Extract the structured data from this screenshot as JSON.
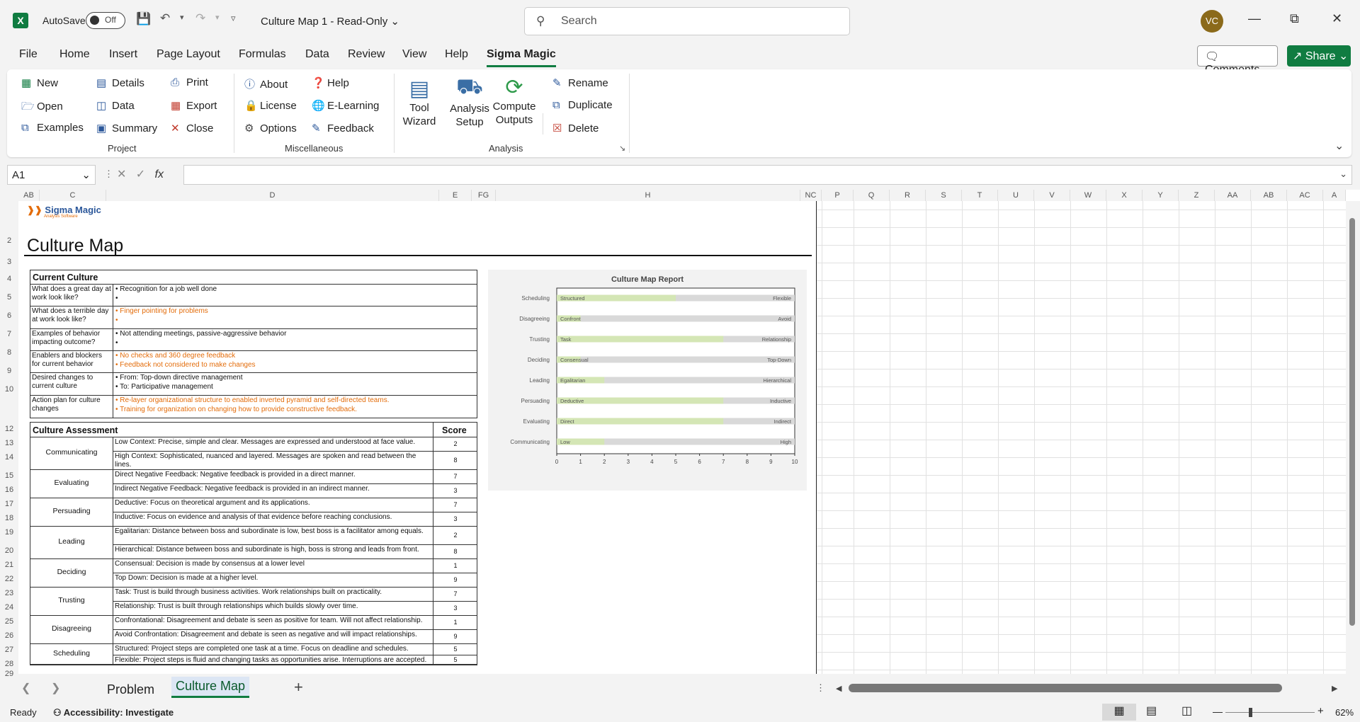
{
  "titlebar": {
    "autosave_label": "AutoSave",
    "toggle_state": "Off",
    "doc_title": "Culture Map 1  -  Read-Only",
    "search_placeholder": "Search",
    "user_initials": "VC"
  },
  "menu": {
    "items": [
      "File",
      "Home",
      "Insert",
      "Page Layout",
      "Formulas",
      "Data",
      "Review",
      "View",
      "Help",
      "Sigma Magic"
    ],
    "active": "Sigma Magic",
    "comments_label": "Comments",
    "share_label": "Share"
  },
  "ribbon": {
    "project": {
      "label": "Project",
      "buttons": [
        "New",
        "Open",
        "Examples",
        "Details",
        "Data",
        "Summary",
        "Print",
        "Export",
        "Close"
      ]
    },
    "misc": {
      "label": "Miscellaneous",
      "buttons": [
        "About",
        "License",
        "Options",
        "Help",
        "E-Learning",
        "Feedback"
      ]
    },
    "analysis": {
      "label": "Analysis",
      "tool_wizard": [
        "Tool",
        "Wizard"
      ],
      "analysis_setup": [
        "Analysis",
        "Setup"
      ],
      "compute_outputs": [
        "Compute",
        "Outputs"
      ],
      "buttons": [
        "Rename",
        "Duplicate",
        "Delete"
      ]
    }
  },
  "formula_bar": {
    "cell_ref": "A1",
    "fx_label": "fx",
    "value": ""
  },
  "columns": [
    "AB",
    "C",
    "D",
    "E",
    "FG",
    "H",
    "NC",
    "P",
    "Q",
    "R",
    "S",
    "T",
    "U",
    "V",
    "W",
    "X",
    "Y",
    "Z",
    "AA",
    "AB",
    "AC",
    "A"
  ],
  "rows": [
    "2",
    "3",
    "4",
    "5",
    "6",
    "7",
    "8",
    "9",
    "10",
    "12",
    "13",
    "14",
    "15",
    "16",
    "17",
    "18",
    "19",
    "20",
    "21",
    "22",
    "23",
    "24",
    "25",
    "26",
    "27",
    "28",
    "29"
  ],
  "doc": {
    "logo_name": "Sigma Magic",
    "logo_sub": "Analysis Software",
    "title": "Culture Map",
    "current_culture": {
      "header": "Current Culture",
      "rows": [
        {
          "q": "What does a great day at work look like?",
          "a": [
            "• Recognition for a job well done",
            "•"
          ],
          "orange": false
        },
        {
          "q": "What does a terrible day at work look like?",
          "a": [
            "• Finger pointing for problems",
            "•"
          ],
          "orange": true
        },
        {
          "q": "Examples of behavior impacting outcome?",
          "a": [
            "• Not attending meetings, passive-aggressive behavior",
            "•"
          ],
          "orange": false
        },
        {
          "q": "Enablers and blockers for current behavior",
          "a": [
            "• No checks and 360 degree feedback",
            "• Feedback not considered to make changes"
          ],
          "orange": true
        },
        {
          "q": "Desired changes to current culture",
          "a": [
            "• From: Top-down directive management",
            "• To: Participative management"
          ],
          "orange": false
        },
        {
          "q": "Action plan for culture changes",
          "a": [
            "• Re-layer organizational structure to enabled inverted pyramid and self-directed teams.",
            "• Training for organization on changing how to provide constructive feedback."
          ],
          "orange": true
        }
      ]
    },
    "assessment": {
      "header": "Culture Assessment",
      "score_header": "Score",
      "groups": [
        {
          "cat": "Communicating",
          "items": [
            {
              "text": "Low Context: Precise, simple and clear. Messages are expressed and understood at face value.",
              "score": "2",
              "orange": false
            },
            {
              "text": "High Context: Sophisticated, nuanced and layered. Messages are spoken and read between the lines.",
              "score": "8",
              "orange": false
            }
          ]
        },
        {
          "cat": "Evaluating",
          "items": [
            {
              "text": "Direct Negative Feedback: Negative feedback is provided in a direct manner.",
              "score": "7",
              "orange": true
            },
            {
              "text": "Indirect Negative Feedback: Negative feedback is provided in an indirect manner.",
              "score": "3",
              "orange": true
            }
          ]
        },
        {
          "cat": "Persuading",
          "items": [
            {
              "text": "Deductive: Focus on theoretical argument and its applications.",
              "score": "7",
              "orange": false
            },
            {
              "text": "Inductive: Focus on evidence and analysis of that evidence before reaching conclusions.",
              "score": "3",
              "orange": false
            }
          ]
        },
        {
          "cat": "Leading",
          "items": [
            {
              "text": "Egalitarian: Distance between boss and subordinate is low, best boss is a facilitator among equals.",
              "score": "2",
              "orange": true
            },
            {
              "text": "Hierarchical: Distance between boss and subordinate is high, boss is strong and leads from front.",
              "score": "8",
              "orange": true
            }
          ]
        },
        {
          "cat": "Deciding",
          "items": [
            {
              "text": "Consensual: Decision is made by consensus at a lower level",
              "score": "1",
              "orange": false
            },
            {
              "text": "Top Down: Decision is made at a higher level.",
              "score": "9",
              "orange": false
            }
          ]
        },
        {
          "cat": "Trusting",
          "items": [
            {
              "text": "Task: Trust is build through business activities. Work relationships built on practicality.",
              "score": "7",
              "orange": true
            },
            {
              "text": "Relationship: Trust is built through relationships which builds slowly over time.",
              "score": "3",
              "orange": true
            }
          ]
        },
        {
          "cat": "Disagreeing",
          "items": [
            {
              "text": "Confrontational: Disagreement and debate is seen as positive for team. Will not affect relationship.",
              "score": "1",
              "orange": false
            },
            {
              "text": "Avoid Confrontation: Disagreement and debate is seen as negative and will impact relationships.",
              "score": "9",
              "orange": false
            }
          ]
        },
        {
          "cat": "Scheduling",
          "items": [
            {
              "text": "Structured: Project steps are completed one task at a time. Focus on deadline and schedules.",
              "score": "5",
              "orange": true
            },
            {
              "text": "Flexible: Project steps is fluid and changing tasks as opportunities arise. Interruptions are accepted.",
              "score": "5",
              "orange": true
            }
          ]
        }
      ]
    }
  },
  "chart_data": {
    "type": "bar",
    "title": "Culture Map Report",
    "categories": [
      "Scheduling",
      "Disagreeing",
      "Trusting",
      "Deciding",
      "Leading",
      "Persuading",
      "Evaluating",
      "Communicating"
    ],
    "left_labels": [
      "Structured",
      "Confront",
      "Task",
      "Consensual",
      "Egalitarian",
      "Deductive",
      "Direct",
      "Low"
    ],
    "right_labels": [
      "Flexible",
      "Avoid",
      "Relationship",
      "Top-Down",
      "Hierarchical",
      "Inductive",
      "Indirect",
      "High"
    ],
    "values": [
      5,
      1,
      7,
      1,
      2,
      7,
      7,
      2
    ],
    "xlim": [
      0,
      10
    ],
    "xticks": [
      "0",
      "1",
      "2",
      "3",
      "4",
      "5",
      "6",
      "7",
      "8",
      "9",
      "10"
    ],
    "colors": {
      "value": "#d4e6b5",
      "remainder": "#d9d9d9"
    }
  },
  "sheets": {
    "tabs": [
      "Problem",
      "Culture Map"
    ],
    "active": "Culture Map",
    "add_label": "+"
  },
  "status": {
    "ready": "Ready",
    "accessibility": "Accessibility: Investigate",
    "zoom": "62%"
  }
}
